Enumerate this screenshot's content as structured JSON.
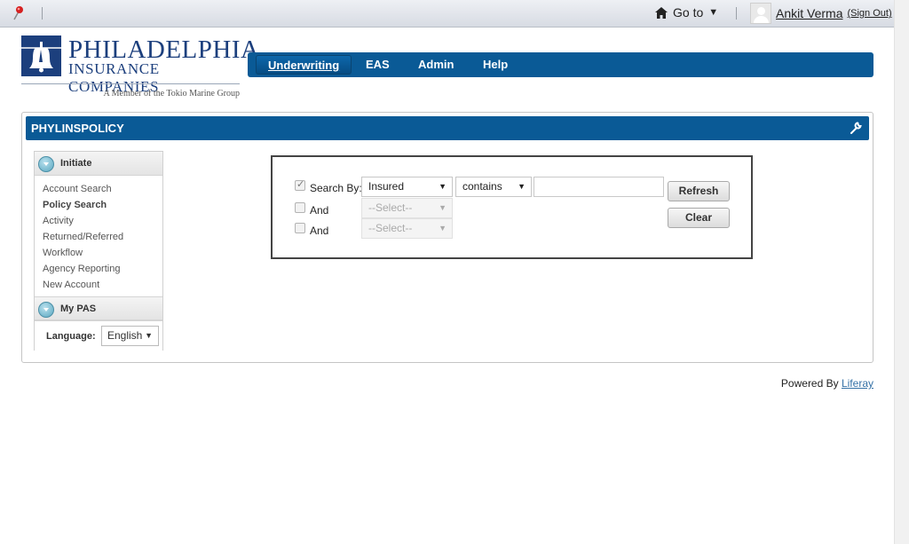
{
  "dock": {
    "goto_label": "Go to",
    "user_name": "Ankit Verma",
    "sign_out_label": "(Sign Out)"
  },
  "logo": {
    "line1": "PHILADELPHIA",
    "line2": "INSURANCE COMPANIES",
    "tagline": "A Member of the Tokio Marine Group"
  },
  "nav": {
    "items": [
      {
        "label": "Underwriting",
        "active": true
      },
      {
        "label": "EAS"
      },
      {
        "label": "Admin"
      },
      {
        "label": "Help"
      }
    ]
  },
  "portlet": {
    "title": "PHYLINSPOLICY"
  },
  "sidebar": {
    "initiate_label": "Initiate",
    "links": [
      "Account Search",
      "Policy Search",
      "Activity",
      "Returned/Referred",
      "Workflow",
      "Agency Reporting",
      "New Account"
    ],
    "mypas_label": "My PAS",
    "language_label": "Language:",
    "language_value": "English"
  },
  "search": {
    "search_by_label": "Search By:",
    "field_value": "Insured",
    "operator_value": "contains",
    "query_value": "",
    "and_label": "And",
    "select_placeholder": "--Select--",
    "refresh_label": "Refresh",
    "clear_label": "Clear"
  },
  "footer": {
    "powered_by": "Powered By",
    "link": "Liferay"
  },
  "colors": {
    "brand_blue": "#0a5a96",
    "logo_blue": "#1c3f7d"
  }
}
